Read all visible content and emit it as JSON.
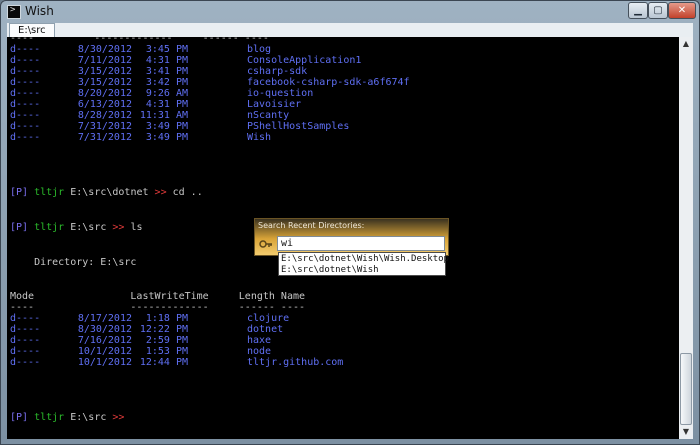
{
  "window": {
    "title": "Wish",
    "app_icon_glyph": ">"
  },
  "tab": {
    "label": "E:\\src"
  },
  "colors": {
    "dir_listing": "#5f6ff3",
    "prompt_path": "#2ab82a",
    "prompt_arrow": "#e23a3a",
    "popup_gold": "#d9a438"
  },
  "console": {
    "top_listing": {
      "separator": "----          -------------     ------ ----",
      "rows": [
        {
          "mode": "d----",
          "date": "8/30/2012",
          "time": "3:45 PM",
          "name": "blog"
        },
        {
          "mode": "d----",
          "date": "7/11/2012",
          "time": "4:31 PM",
          "name": "ConsoleApplication1"
        },
        {
          "mode": "d----",
          "date": "3/15/2012",
          "time": "3:41 PM",
          "name": "csharp-sdk"
        },
        {
          "mode": "d----",
          "date": "3/15/2012",
          "time": "3:42 PM",
          "name": "facebook-csharp-sdk-a6f674f"
        },
        {
          "mode": "d----",
          "date": "8/20/2012",
          "time": "9:26 AM",
          "name": "io-question"
        },
        {
          "mode": "d----",
          "date": "6/13/2012",
          "time": "4:31 PM",
          "name": "Lavoisier"
        },
        {
          "mode": "d----",
          "date": "8/28/2012",
          "time": "11:31 AM",
          "name": "nScanty"
        },
        {
          "mode": "d----",
          "date": "7/31/2012",
          "time": "3:49 PM",
          "name": "PShellHostSamples"
        },
        {
          "mode": "d----",
          "date": "7/31/2012",
          "time": "3:49 PM",
          "name": "Wish"
        }
      ]
    },
    "prompt1": {
      "tag": "[P]",
      "user": "tltjr",
      "path": "E:\\src\\dotnet",
      "arrow": ">>",
      "command": "cd .."
    },
    "prompt2": {
      "tag": "[P]",
      "user": "tltjr",
      "path": "E:\\src",
      "arrow": ">>",
      "command": "ls"
    },
    "directory_line": "    Directory: E:\\src",
    "header_line": "Mode                LastWriteTime     Length Name",
    "separator_line": "----                -------------     ------ ----",
    "bottom_listing": {
      "rows": [
        {
          "mode": "d----",
          "date": "8/17/2012",
          "time": "1:18 PM",
          "name": "clojure"
        },
        {
          "mode": "d----",
          "date": "8/30/2012",
          "time": "12:22 PM",
          "name": "dotnet"
        },
        {
          "mode": "d----",
          "date": "7/16/2012",
          "time": "2:59 PM",
          "name": "haxe"
        },
        {
          "mode": "d----",
          "date": "10/1/2012",
          "time": "1:53 PM",
          "name": "node"
        },
        {
          "mode": "d----",
          "date": "10/1/2012",
          "time": "12:44 PM",
          "name": "tltjr.github.com"
        }
      ]
    },
    "prompt3": {
      "tag": "[P]",
      "user": "tltjr",
      "path": "E:\\src",
      "arrow": ">>"
    }
  },
  "popup": {
    "title": "Search Recent Directories:",
    "icon": "key-icon",
    "input_value": "wi",
    "suggestions": [
      "E:\\src\\dotnet\\Wish\\Wish.Desktop",
      "E:\\src\\dotnet\\Wish"
    ]
  }
}
